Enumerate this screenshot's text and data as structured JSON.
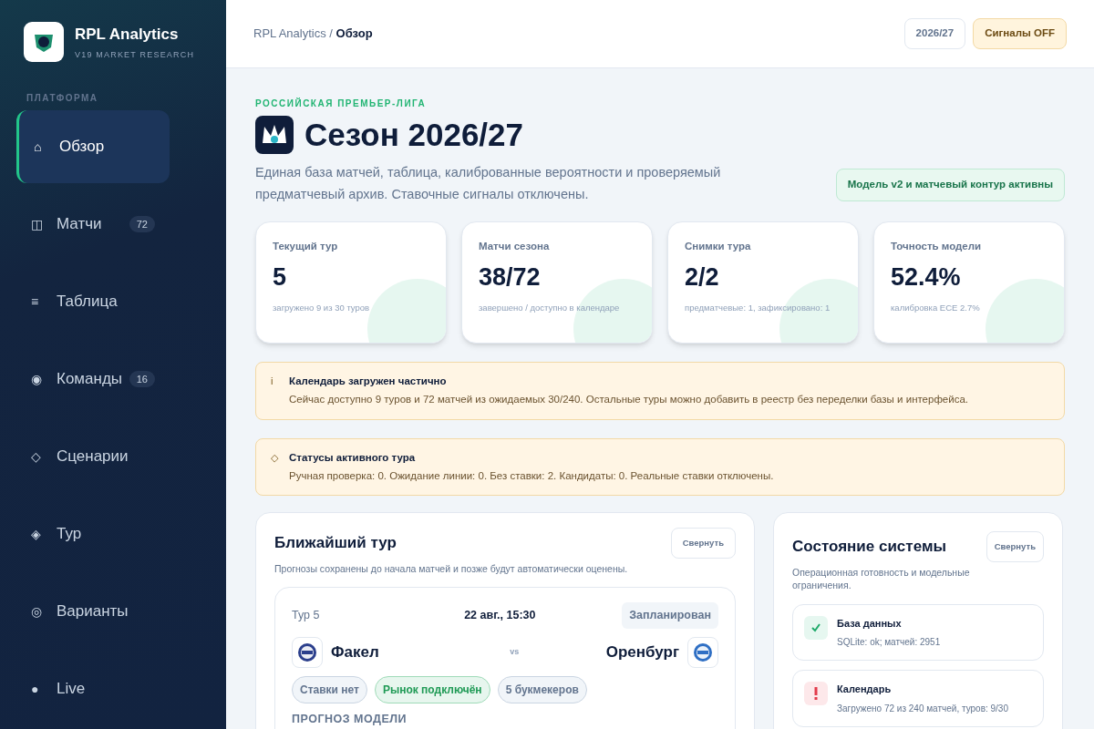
{
  "brand": {
    "title": "RPL Analytics",
    "subtitle": "V19 MARKET RESEARCH"
  },
  "sidebar": {
    "section": "ПЛАТФОРМА",
    "items": [
      {
        "icon": "⌂",
        "label": "Обзор",
        "selected": true
      },
      {
        "icon": "◫",
        "label": "Матчи",
        "badge": "72",
        "selected": false
      },
      {
        "icon": "≡",
        "label": "Таблица",
        "selected": false
      },
      {
        "icon": "◉",
        "label": "Команды",
        "badge": "16",
        "selected": false
      },
      {
        "icon": "◇",
        "label": "Сценарии",
        "selected": false
      },
      {
        "icon": "◈",
        "label": "Тур",
        "selected": false
      },
      {
        "icon": "◎",
        "label": "Варианты",
        "selected": false
      },
      {
        "icon": "●",
        "label": "Live",
        "selected": false
      }
    ]
  },
  "breadcrumb": {
    "parent": "RPL Analytics /",
    "current": "Обзор"
  },
  "header_buttons": [
    {
      "label": "2026/27",
      "kind": "plain"
    },
    {
      "label": "Сигналы OFF",
      "kind": "warning"
    }
  ],
  "hero": {
    "eyebrow": "РОССИЙСКАЯ ПРЕМЬЕР-ЛИГА",
    "title": "Сезон 2026/27",
    "description": "Единая база матчей, таблица, калиброванные вероятности и проверяемый предматчевый архив. Ставочные сигналы отключены.",
    "status": "Модель v2 и матчевый контур активны"
  },
  "stats": [
    {
      "label": "Текущий тур",
      "value": "5",
      "note": "загружено 9 из 30 туров"
    },
    {
      "label": "Матчи сезона",
      "value": "38/72",
      "note": "завершено / доступно в календаре"
    },
    {
      "label": "Снимки тура",
      "value": "2/2",
      "note": "предматчевые: 1, зафиксировано: 1"
    },
    {
      "label": "Точность модели",
      "value": "52.4%",
      "note": "калибровка ECE 2.7%"
    }
  ],
  "alerts": [
    {
      "icon": "i",
      "title": "Календарь загружен частично",
      "text": "Сейчас доступно 9 туров и 72 матчей из ожидаемых 30/240. Остальные туры можно добавить в реестр без переделки базы и интерфейса."
    },
    {
      "icon": "◇",
      "title": "Статусы активного тура",
      "text": "Ручная проверка: 0. Ожидание линии: 0. Без ставки: 2. Кандидаты: 0. Реальные ставки отключены."
    }
  ],
  "next_round": {
    "title": "Ближайший тур",
    "subtitle": "Прогнозы сохранены до начала матчей и позже будут автоматически оценены.",
    "collapse": "Свернуть",
    "match": {
      "round": "Тур 5",
      "datetime": "22 авг., 15:30",
      "status": "Запланирован",
      "home": "Факел",
      "vs": "vs",
      "away": "Оренбург",
      "tags": [
        {
          "label": "Ставки нет",
          "kind": "neutral"
        },
        {
          "label": "Рынок подключён",
          "kind": "success"
        },
        {
          "label": "5 букмекеров",
          "kind": "neutral"
        }
      ],
      "section": "ПРОГНОЗ МОДЕЛИ"
    }
  },
  "system": {
    "title": "Состояние системы",
    "subtitle": "Операционная готовность и модельные ограничения.",
    "collapse": "Свернуть",
    "items": [
      {
        "kind": "ok",
        "title": "База данных",
        "text": "SQLite: ok; матчей: 2951"
      },
      {
        "kind": "error",
        "title": "Календарь",
        "text": "Загружено 72 из 240 матчей, туров: 9/30"
      }
    ]
  }
}
